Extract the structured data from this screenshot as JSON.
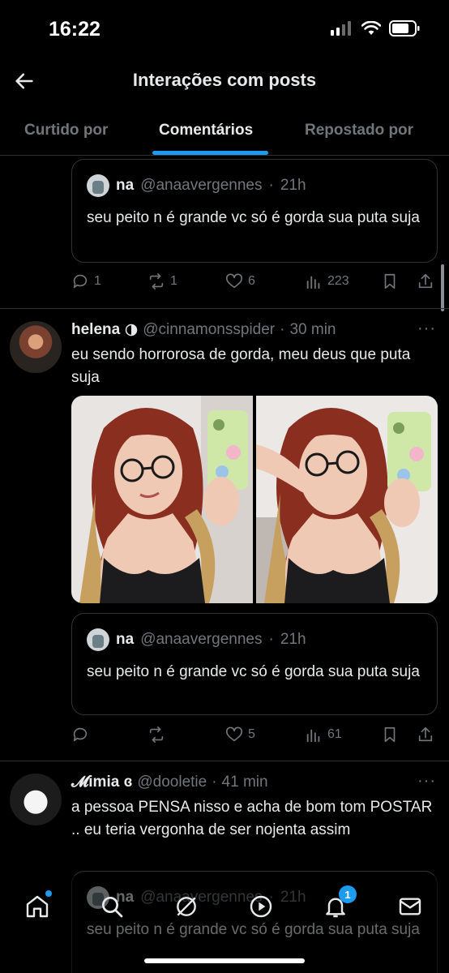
{
  "status": {
    "time": "16:22"
  },
  "header": {
    "title": "Interações com posts"
  },
  "tabs": [
    {
      "label": "Curtido por"
    },
    {
      "label": "Comentários"
    },
    {
      "label": "Repostado por"
    }
  ],
  "quoted": {
    "name": "na",
    "handle": "@anaavergennes",
    "sep": "·",
    "time": "21h",
    "text": "seu peito n é grande vc só é gorda sua puta suja"
  },
  "posts": [
    {
      "actions": {
        "replies": "1",
        "reposts": "1",
        "likes": "6",
        "views": "223"
      }
    },
    {
      "name": "helena",
      "handle": "@cinnamonsspider",
      "sep": "·",
      "time": "30 min",
      "text": "eu sendo horrorosa de gorda, meu deus que puta suja",
      "actions": {
        "replies": "",
        "reposts": "",
        "likes": "5",
        "views": "61"
      }
    },
    {
      "name": "𝓜imia ɞ",
      "handle": "@dooletie",
      "sep": "·",
      "time": "41 min",
      "text": "a pessoa PENSA nisso e acha de bom tom POSTAR .. eu teria vergonha de ser nojenta assim"
    }
  ],
  "more_label": "···",
  "nav": {
    "notifications_badge": "1"
  },
  "colors": {
    "accent": "#1d9bf0",
    "background": "#000000",
    "muted": "#71767b"
  }
}
